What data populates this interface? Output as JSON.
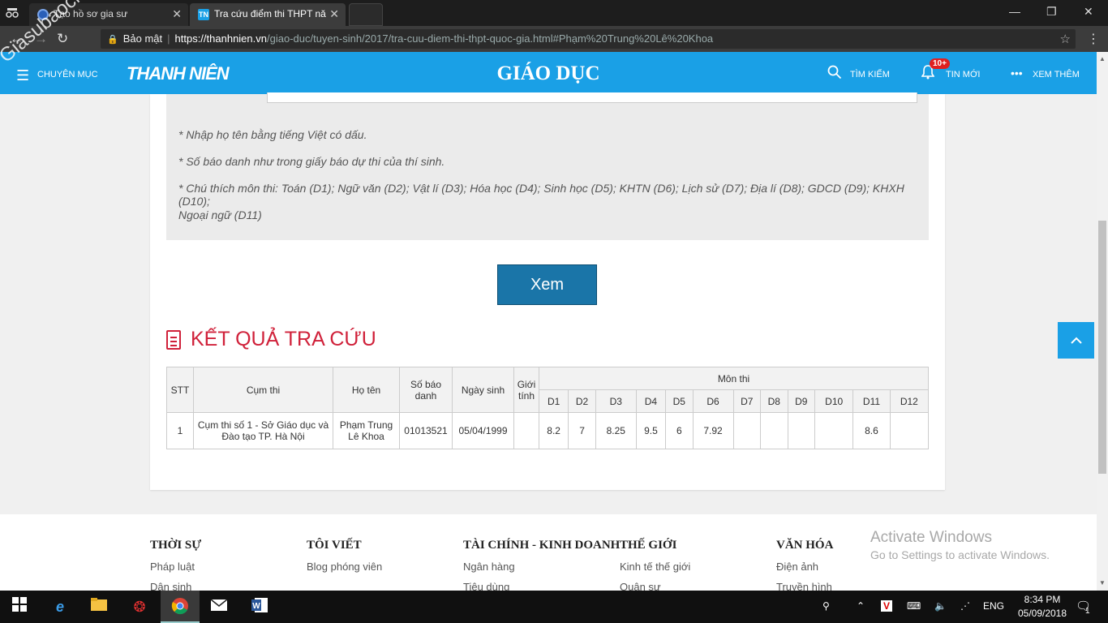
{
  "browser": {
    "tabs": [
      {
        "title": "Tạo hồ sơ gia sư"
      },
      {
        "title": "Tra cứu điểm thi THPT nă",
        "favicon": "TN"
      }
    ],
    "address": {
      "secure_label": "Bảo mật",
      "host": "https://thanhnien.vn",
      "path": "/giao-duc/tuyen-sinh/2017/tra-cuu-diem-thi-thpt-quoc-gia.html#Phạm%20Trung%20Lê%20Khoa"
    }
  },
  "watermark": "Giasubaochau.net",
  "header": {
    "menu_label": "CHUYÊN MỤC",
    "logo": "THANH NIÊN",
    "section_title": "GIÁO DỤC",
    "search_label": "TÌM KIẾM",
    "notify_label": "TIN MỚI",
    "notify_badge": "10+",
    "more_label": "XEM THÊM"
  },
  "notes": [
    "* Nhập họ tên bằng tiếng Việt có dấu.",
    "* Số báo danh như trong giấy báo dự thi của thí sinh.",
    "* Chú thích môn thi: Toán (D1); Ngữ văn (D2); Vật lí (D3); Hóa học (D4); Sinh học (D5); KHTN (D6); Lịch sử (D7); Địa lí (D8); GDCD (D9); KHXH (D10);",
    "Ngoại ngữ (D11)"
  ],
  "submit_label": "Xem",
  "result_title": "KẾT QUẢ TRA CỨU",
  "table": {
    "headers": {
      "stt": "STT",
      "cluster": "Cụm thi",
      "name": "Họ tên",
      "sbd": "Số báo danh",
      "dob": "Ngày sinh",
      "gender": "Giới tính",
      "subjects": "Môn thi"
    },
    "subject_codes": [
      "D1",
      "D2",
      "D3",
      "D4",
      "D5",
      "D6",
      "D7",
      "D8",
      "D9",
      "D10",
      "D11",
      "D12"
    ],
    "row": {
      "stt": "1",
      "cluster": "Cụm thi số 1 - Sở Giáo dục và Đào tạo TP. Hà Nội",
      "name": "Phạm Trung Lê Khoa",
      "sbd": "01013521",
      "dob": "05/04/1999",
      "gender": "",
      "scores": [
        "8.2",
        "7",
        "8.25",
        "9.5",
        "6",
        "7.92",
        "",
        "",
        "",
        "",
        "8.6",
        ""
      ]
    }
  },
  "footer": [
    {
      "heading": "THỜI SỰ",
      "links": [
        "Pháp luật",
        "Dân sinh"
      ]
    },
    {
      "heading": "TÔI VIẾT",
      "links": [
        "Blog phóng viên"
      ]
    },
    {
      "heading": "TÀI CHÍNH - KINH DOANH",
      "links": [
        "Ngân hàng",
        "Tiêu dùng"
      ]
    },
    {
      "heading": "THẾ GIỚI",
      "links": [
        "Kinh tế thế giới",
        "Quân sự"
      ]
    },
    {
      "heading": "VĂN HÓA",
      "links": [
        "Điện ảnh",
        "Truyền hình"
      ]
    }
  ],
  "activate": {
    "line1": "Activate Windows",
    "line2": "Go to Settings to activate Windows."
  },
  "taskbar": {
    "language": "ENG",
    "time": "8:34 PM",
    "date": "05/09/2018",
    "notification_count": "1"
  }
}
